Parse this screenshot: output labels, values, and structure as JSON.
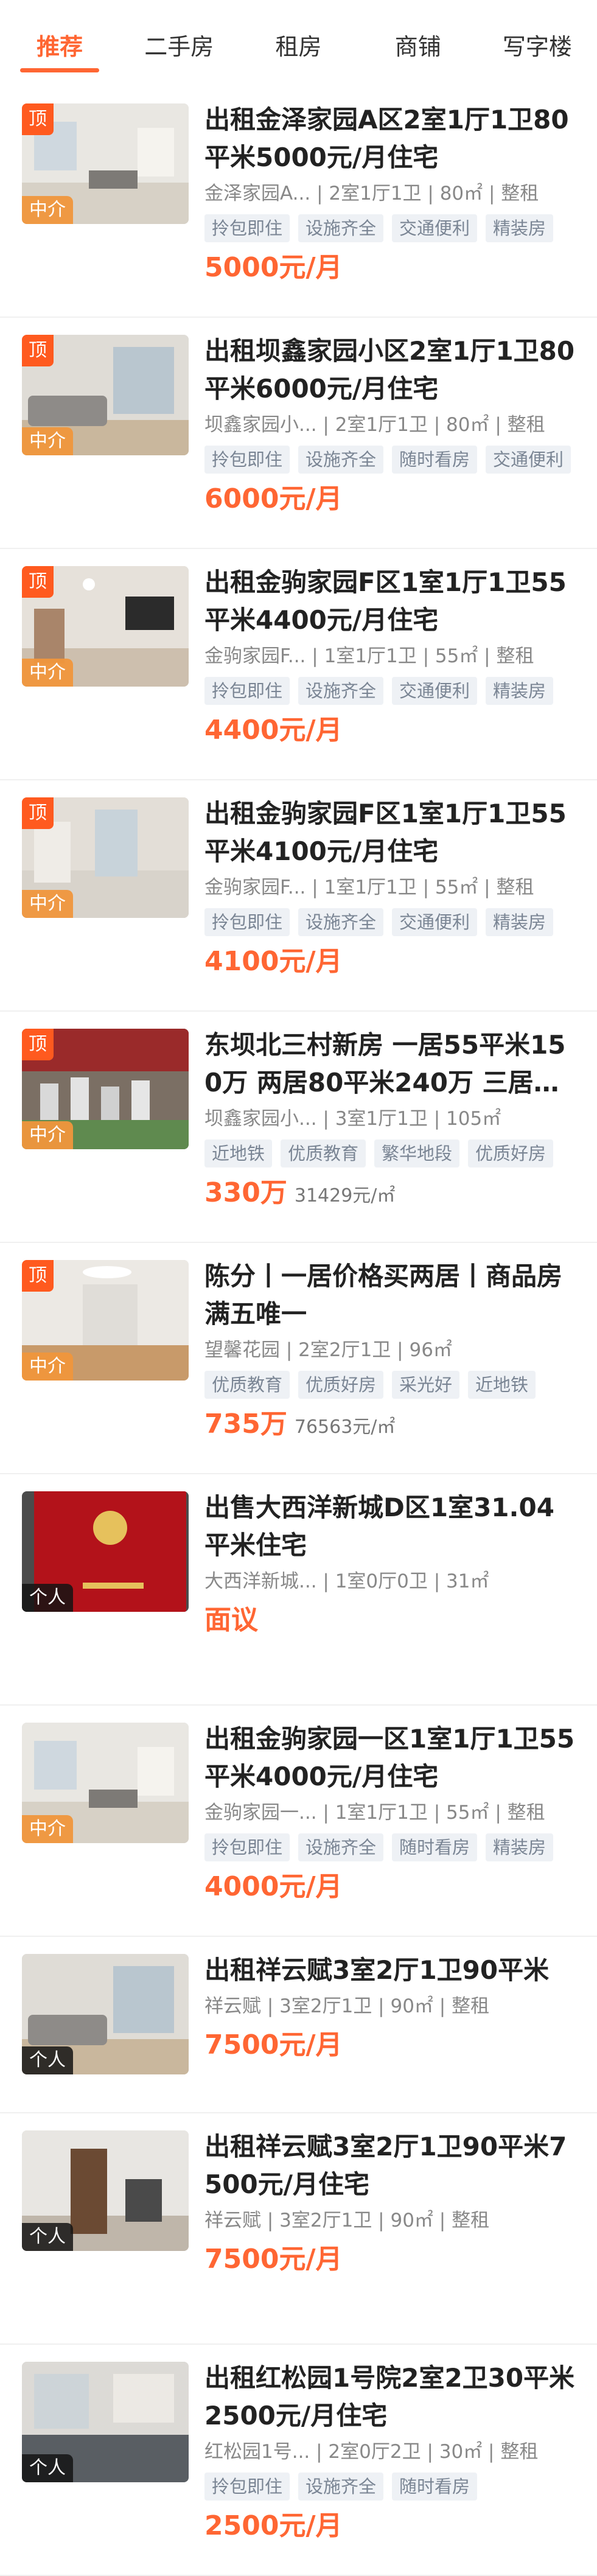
{
  "tabs": [
    {
      "label": "推荐",
      "active": true
    },
    {
      "label": "二手房",
      "active": false
    },
    {
      "label": "租房",
      "active": false
    },
    {
      "label": "商铺",
      "active": false
    },
    {
      "label": "写字楼",
      "active": false
    }
  ],
  "listings": [
    {
      "title": "出租金泽家园A区2室1厅1卫80平米5000元/月住宅",
      "meta": "金泽家园A... | 2室1厅1卫 | 80㎡ | 整租",
      "tags": [
        "拎包即住",
        "设施齐全",
        "交通便利",
        "精装房"
      ],
      "price": "5000元/月",
      "unit_price": "",
      "top": "顶",
      "source": "中介",
      "source_type": "agent",
      "photo": "room-light"
    },
    {
      "title": "出租坝鑫家园小区2室1厅1卫80平米6000元/月住宅",
      "meta": "坝鑫家园小... | 2室1厅1卫 | 80㎡ | 整租",
      "tags": [
        "拎包即住",
        "设施齐全",
        "随时看房",
        "交通便利"
      ],
      "price": "6000元/月",
      "unit_price": "",
      "top": "顶",
      "source": "中介",
      "source_type": "agent",
      "photo": "room-sofa"
    },
    {
      "title": "出租金驹家园F区1室1厅1卫55平米4400元/月住宅",
      "meta": "金驹家园F... | 1室1厅1卫 | 55㎡ | 整租",
      "tags": [
        "拎包即住",
        "设施齐全",
        "交通便利",
        "精装房"
      ],
      "price": "4400元/月",
      "unit_price": "",
      "top": "顶",
      "source": "中介",
      "source_type": "agent",
      "photo": "room-tv"
    },
    {
      "title": "出租金驹家园F区1室1厅1卫55平米4100元/月住宅",
      "meta": "金驹家园F... | 1室1厅1卫 | 55㎡ | 整租",
      "tags": [
        "拎包即住",
        "设施齐全",
        "交通便利",
        "精装房"
      ],
      "price": "4100元/月",
      "unit_price": "",
      "top": "顶",
      "source": "中介",
      "source_type": "agent",
      "photo": "room-floor"
    },
    {
      "title": "东坝北三村新房 一居55平米150万 两居80平米240万 三居…",
      "meta": "坝鑫家园小... | 3室1厅1卫 | 105㎡",
      "tags": [
        "近地铁",
        "优质教育",
        "繁华地段",
        "优质好房"
      ],
      "price": "330万",
      "unit_price": "31429元/㎡",
      "top": "顶",
      "source": "中介",
      "source_type": "agent",
      "photo": "model"
    },
    {
      "title": "陈分丨一居价格买两居丨商品房满五唯一",
      "meta": "望馨花园 | 2室2厅1卫 | 96㎡",
      "tags": [
        "优质教育",
        "优质好房",
        "采光好",
        "近地铁"
      ],
      "price": "735万",
      "unit_price": "76563元/㎡",
      "top": "顶",
      "source": "中介",
      "source_type": "agent",
      "photo": "room-empty"
    },
    {
      "title": "出售大西洋新城D区1室31.04平米住宅",
      "meta": "大西洋新城... | 1室0厅0卫 | 31㎡",
      "tags": [],
      "price": "面议",
      "unit_price": "",
      "top": "",
      "source": "个人",
      "source_type": "person",
      "photo": "certificate"
    },
    {
      "title": "出租金驹家园一区1室1厅1卫55平米4000元/月住宅",
      "meta": "金驹家园一... | 1室1厅1卫 | 55㎡ | 整租",
      "tags": [
        "拎包即住",
        "设施齐全",
        "随时看房",
        "精装房"
      ],
      "price": "4000元/月",
      "unit_price": "",
      "top": "",
      "source": "中介",
      "source_type": "agent",
      "photo": "room-light"
    },
    {
      "title": "出租祥云赋3室2厅1卫90平米",
      "meta": "祥云赋 | 3室2厅1卫 | 90㎡ | 整租",
      "tags": [],
      "price": "7500元/月",
      "unit_price": "",
      "top": "",
      "source": "个人",
      "source_type": "person",
      "photo": "room-sofa"
    },
    {
      "title": "出租祥云赋3室2厅1卫90平米7500元/月住宅",
      "meta": "祥云赋 | 3室2厅1卫 | 90㎡ | 整租",
      "tags": [],
      "price": "7500元/月",
      "unit_price": "",
      "top": "",
      "source": "个人",
      "source_type": "person",
      "photo": "room-door"
    },
    {
      "title": "出租红松园1号院2室2卫30平米2500元/月住宅",
      "meta": "红松园1号... | 2室0厅2卫 | 30㎡ | 整租",
      "tags": [
        "拎包即住",
        "设施齐全",
        "随时看房"
      ],
      "price": "2500元/月",
      "unit_price": "",
      "top": "",
      "source": "个人",
      "source_type": "person",
      "photo": "kitchen"
    }
  ]
}
